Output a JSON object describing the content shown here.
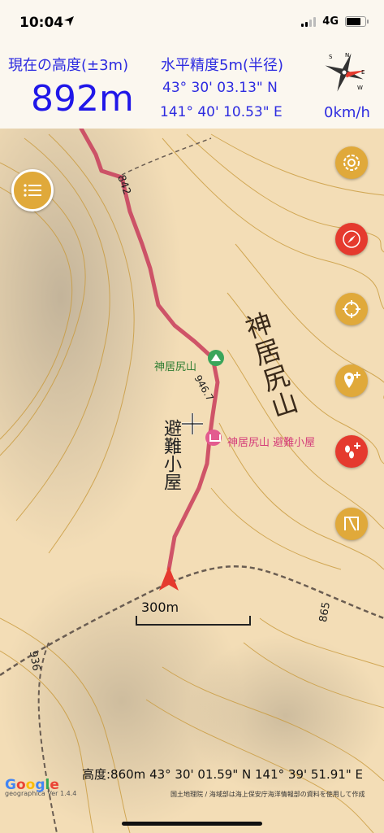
{
  "status_bar": {
    "time": "10:04",
    "network": "4G",
    "icons": [
      "location-arrow-icon",
      "signal-icon",
      "battery-icon"
    ]
  },
  "info": {
    "altitude_label": "現在の高度(±3m)",
    "altitude_value": "892m",
    "accuracy_label": "水平精度5m(半径)",
    "latitude": "43° 30' 03.13\" N",
    "longitude": "141° 40' 10.53\" E",
    "speed": "0km/h",
    "compass_letters": [
      "N",
      "E",
      "S",
      "W"
    ]
  },
  "map": {
    "peak_label": "神居尻山",
    "hut_label": "神居尻山 避難小屋",
    "mountain_name": "神居尻山",
    "hut_name": "避難小屋",
    "elevations": {
      "e842": "842",
      "e946": "946.7",
      "e865": "865",
      "e936": "936"
    },
    "scale_label": "300m"
  },
  "buttons": {
    "menu": "menu-icon",
    "right": [
      "layers-icon",
      "compass-mode-icon",
      "location-target-icon",
      "add-place-icon",
      "add-footprint-icon",
      "ruler-icon"
    ]
  },
  "footer": {
    "coords": "高度:860m  43° 30' 01.59\" N 141° 39' 51.91\" E",
    "google": [
      "G",
      "o",
      "o",
      "g",
      "l",
      "e"
    ],
    "version": "geographica Ver 1.4.4",
    "credits": "国土地理院 / 海域部は海上保安庁海洋情報部の資料を使用して作成"
  },
  "colors": {
    "accent_text": "#2d2be0",
    "map_background": "#f3ddb6",
    "track": "#c83c5a",
    "gold_button": "#e0a93a",
    "red_button": "#e53a2e"
  }
}
